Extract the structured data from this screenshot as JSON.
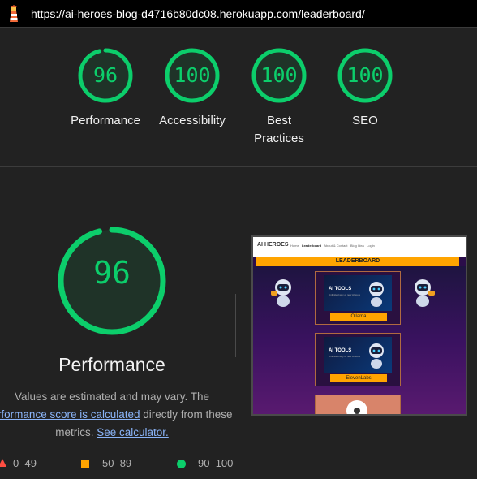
{
  "url": "https://ai-heroes-blog-d4716b80dc08.herokuapp.com/leaderboard/",
  "colors": {
    "pass": "#0cce6b",
    "average": "#ffa400",
    "background": "#222222"
  },
  "categories": [
    {
      "score": "96",
      "label": "Performance",
      "fraction": 0.96
    },
    {
      "score": "100",
      "label": "Accessibility",
      "fraction": 1.0
    },
    {
      "score": "100",
      "label": "Best Practices",
      "label_line1": "Best",
      "label_line2": "Practices",
      "fraction": 1.0
    },
    {
      "score": "100",
      "label": "SEO",
      "fraction": 1.0
    }
  ],
  "performance": {
    "score": "96",
    "fraction": 0.96,
    "title": "Performance",
    "desc_prefix": "Values are estimated and may vary. The",
    "link_score": "erformance score is calculated",
    "desc_middle": "directly from these metrics.",
    "link_calc": "See calculator."
  },
  "legend": {
    "fail": "0–49",
    "average": "50–89",
    "pass": "90–100"
  },
  "thumbnail": {
    "site_logo": "AI HEROES",
    "nav_links": [
      "Home",
      "Leaderboard",
      "About & Contact",
      "Blog Idea",
      "Login"
    ],
    "banner": "LEADERBOARD",
    "cards": [
      {
        "title": "AI TOOLS",
        "subtitle": "Unlimited way of new AI tools",
        "button": "Ollama"
      },
      {
        "title": "AI TOOLS",
        "subtitle": "Unlimited way of new AI tools",
        "button": "ElevenLabs"
      }
    ]
  }
}
